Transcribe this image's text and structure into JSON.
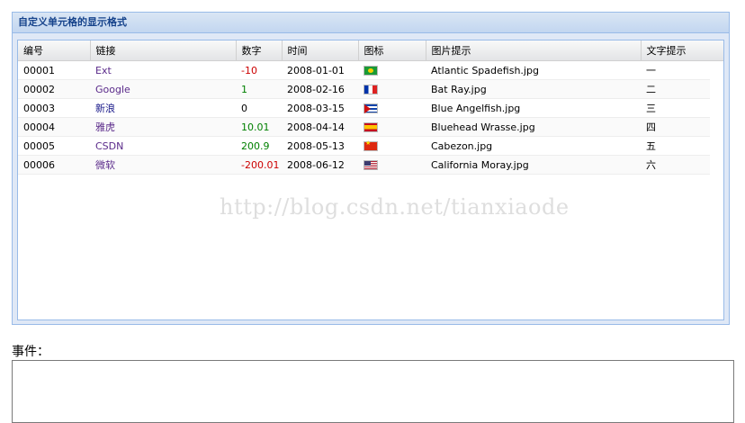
{
  "panel": {
    "title": "自定义单元格的显示格式"
  },
  "grid": {
    "columns": [
      "编号",
      "链接",
      "数字",
      "时间",
      "图标",
      "图片提示",
      "文字提示"
    ],
    "rows": [
      {
        "id": "00001",
        "link": "Ext",
        "number": "-10",
        "number_sign": "neg",
        "date": "2008-01-01",
        "flag": "brazil-flag-icon",
        "image": "Atlantic Spadefish.jpg",
        "text": "一"
      },
      {
        "id": "00002",
        "link": "Google",
        "number": "1",
        "number_sign": "pos",
        "date": "2008-02-16",
        "flag": "france-flag-icon",
        "image": "Bat Ray.jpg",
        "text": "二"
      },
      {
        "id": "00003",
        "link": "新浪",
        "number": "0",
        "number_sign": "zero",
        "date": "2008-03-15",
        "flag": "cuba-flag-icon",
        "image": "Blue Angelfish.jpg",
        "text": "三"
      },
      {
        "id": "00004",
        "link": "雅虎",
        "number": "10.01",
        "number_sign": "pos",
        "date": "2008-04-14",
        "flag": "spain-flag-icon",
        "image": "Bluehead Wrasse.jpg",
        "text": "四"
      },
      {
        "id": "00005",
        "link": "CSDN",
        "number": "200.9",
        "number_sign": "pos",
        "date": "2008-05-13",
        "flag": "china-flag-icon",
        "image": "Cabezon.jpg",
        "text": "五"
      },
      {
        "id": "00006",
        "link": "微软",
        "number": "-200.01",
        "number_sign": "neg",
        "date": "2008-06-12",
        "flag": "usa-flag-icon",
        "image": "California Moray.jpg",
        "text": "六"
      }
    ]
  },
  "watermark": "http://blog.csdn.net/tianxiaode",
  "event": {
    "label": "事件：",
    "value": ""
  },
  "colors": {
    "panel_border": "#99bbe8",
    "header_text": "#15428b",
    "negative": "#cc0000",
    "positive": "#008000",
    "link": "#5a2a8a"
  }
}
